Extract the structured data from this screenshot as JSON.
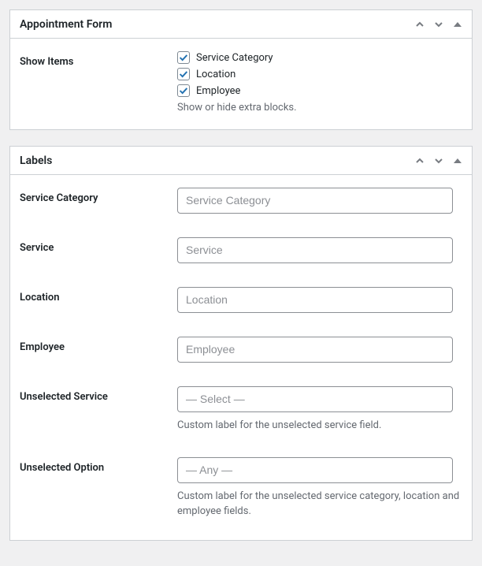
{
  "panels": {
    "appointment": {
      "title": "Appointment Form",
      "showItems": {
        "label": "Show Items",
        "options": [
          {
            "label": "Service Category",
            "checked": true
          },
          {
            "label": "Location",
            "checked": true
          },
          {
            "label": "Employee",
            "checked": true
          }
        ],
        "description": "Show or hide extra blocks."
      }
    },
    "labels": {
      "title": "Labels",
      "fields": {
        "serviceCategory": {
          "label": "Service Category",
          "placeholder": "Service Category",
          "value": ""
        },
        "service": {
          "label": "Service",
          "placeholder": "Service",
          "value": ""
        },
        "location": {
          "label": "Location",
          "placeholder": "Location",
          "value": ""
        },
        "employee": {
          "label": "Employee",
          "placeholder": "Employee",
          "value": ""
        },
        "unselectedService": {
          "label": "Unselected Service",
          "placeholder": "— Select —",
          "value": "",
          "description": "Custom label for the unselected service field."
        },
        "unselectedOption": {
          "label": "Unselected Option",
          "placeholder": "— Any —",
          "value": "",
          "description": "Custom label for the unselected service category, location and employee fields."
        }
      }
    }
  },
  "icons": {
    "checkColor": "#2271b1"
  }
}
